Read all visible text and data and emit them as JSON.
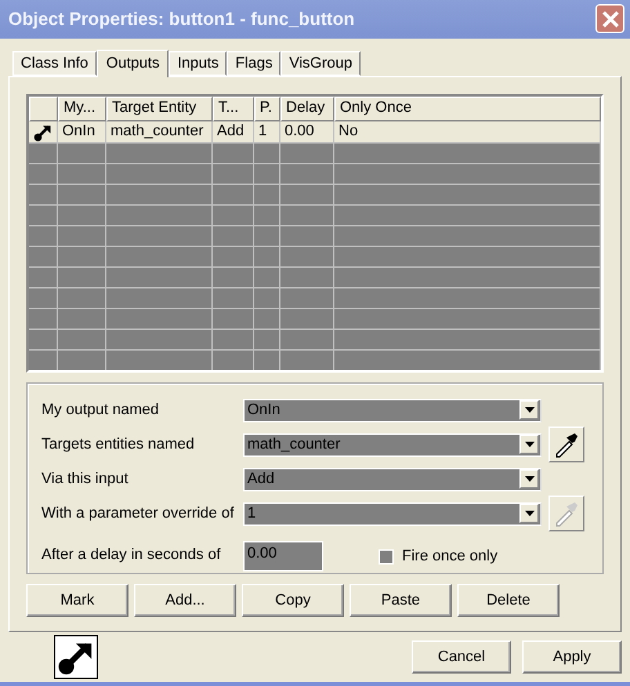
{
  "window": {
    "title": "Object Properties: button1 - func_button"
  },
  "tabs": [
    {
      "label": "Class Info",
      "selected": false
    },
    {
      "label": "Outputs",
      "selected": true
    },
    {
      "label": "Inputs",
      "selected": false
    },
    {
      "label": "Flags",
      "selected": false
    },
    {
      "label": "VisGroup",
      "selected": false
    }
  ],
  "table": {
    "columns": [
      "My...",
      "Target Entity",
      "T...",
      "P.",
      "Delay",
      "Only Once"
    ],
    "rows": [
      {
        "selected": true,
        "cells": [
          "OnIn",
          "math_counter",
          "Add",
          "1",
          "0.00",
          "No"
        ]
      }
    ]
  },
  "form": {
    "fields": [
      {
        "label": "My output named",
        "value": "OnIn"
      },
      {
        "label": "Targets entities named",
        "value": "math_counter",
        "picker": {
          "disabled": false
        }
      },
      {
        "label": "Via this input",
        "value": "Add"
      },
      {
        "label": "With a parameter override of",
        "value": "1",
        "picker": {
          "disabled": true
        }
      }
    ],
    "delay": {
      "label": "After a delay in seconds of",
      "value": "0.00"
    },
    "fire_once": {
      "label": "Fire once only",
      "checked": false
    }
  },
  "actions": [
    "Mark",
    "Add...",
    "Copy",
    "Paste",
    "Delete"
  ],
  "buttons": [
    "Cancel",
    "Apply"
  ]
}
